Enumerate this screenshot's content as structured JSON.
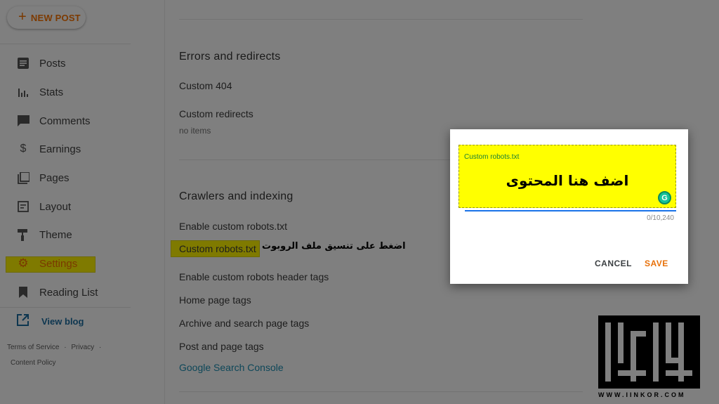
{
  "sidebar": {
    "new_post_label": "NEW POST",
    "items": [
      {
        "label": "Posts",
        "icon": "posts-icon"
      },
      {
        "label": "Stats",
        "icon": "stats-icon"
      },
      {
        "label": "Comments",
        "icon": "comments-icon"
      },
      {
        "label": "Earnings",
        "icon": "dollar-icon"
      },
      {
        "label": "Pages",
        "icon": "pages-icon"
      },
      {
        "label": "Layout",
        "icon": "layout-icon"
      },
      {
        "label": "Theme",
        "icon": "theme-roller-icon"
      },
      {
        "label": "Settings",
        "icon": "gear-icon"
      },
      {
        "label": "Reading List",
        "icon": "bookmark-icon"
      }
    ],
    "view_blog_label": "View blog",
    "footer": {
      "terms": "Terms of Service",
      "privacy": "Privacy",
      "content_policy": "Content Policy",
      "separator": "·"
    }
  },
  "main": {
    "errors_section": {
      "title": "Errors and redirects",
      "custom_404": "Custom 404",
      "custom_redirects": "Custom redirects",
      "custom_redirects_value": "no items"
    },
    "crawlers_section": {
      "title": "Crawlers and indexing",
      "enable_robots": "Enable custom robots.txt",
      "custom_robots": "Custom robots.txt",
      "custom_robots_annotation": "اضغط على تنسيق ملف الروبوت",
      "enable_robots_header": "Enable custom robots header tags",
      "home_page_tags": "Home page tags",
      "archive_tags": "Archive and search page tags",
      "post_page_tags": "Post and page tags",
      "search_console": "Google Search Console"
    }
  },
  "dialog": {
    "field_label": "Custom robots.txt",
    "field_content": "اضف هنا المحتوى",
    "counter": "0/10,240",
    "cancel_label": "CANCEL",
    "save_label": "SAVE"
  },
  "watermark": {
    "text": "WWW.IINKOR.COM"
  },
  "colors": {
    "highlight": "#ffff00",
    "save_accent": "#e8710a",
    "link": "#1a73e8"
  }
}
